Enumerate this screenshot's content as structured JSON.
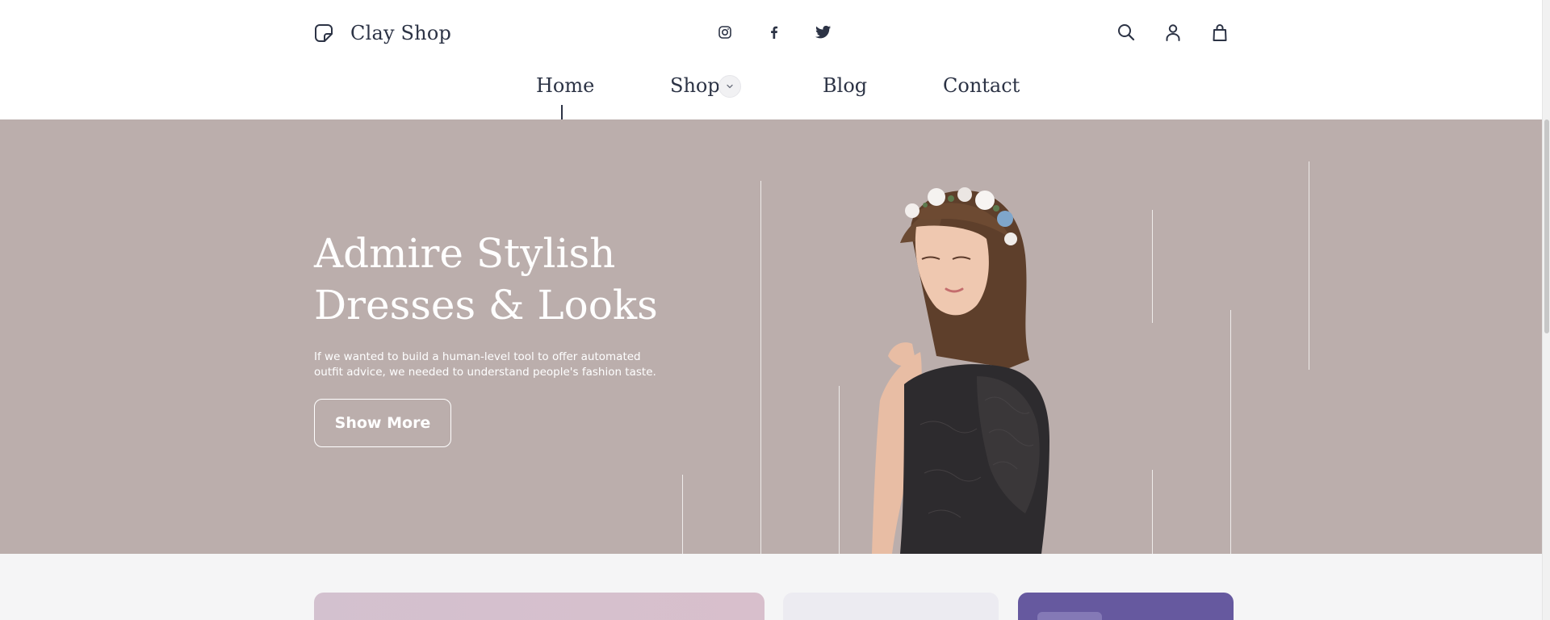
{
  "brand": {
    "name": "Clay Shop",
    "logo_icon": "sticky-note-icon"
  },
  "social": [
    {
      "name": "instagram",
      "icon": "instagram-icon"
    },
    {
      "name": "facebook",
      "icon": "facebook-icon"
    },
    {
      "name": "twitter",
      "icon": "twitter-icon"
    }
  ],
  "utilities": [
    {
      "name": "search",
      "icon": "search-icon"
    },
    {
      "name": "account",
      "icon": "user-icon"
    },
    {
      "name": "cart",
      "icon": "shopping-bag-icon"
    }
  ],
  "nav": {
    "items": [
      {
        "label": "Home",
        "active": true
      },
      {
        "label": "Shop",
        "has_dropdown": true
      },
      {
        "label": "Blog"
      },
      {
        "label": "Contact"
      }
    ],
    "dropdown_icon": "chevron-down-icon"
  },
  "hero": {
    "title_line1": "Admire Stylish",
    "title_line2": "Dresses & Looks",
    "description": "If we wanted to build a human-level tool to offer automated outfit advice, we needed to understand people's fashion taste.",
    "button_label": "Show More"
  },
  "colors": {
    "hero_bg": "#bbaeac",
    "text_dark": "#2c3345",
    "section_bg": "#f5f5f6",
    "card_pink": "#d3c1cf",
    "card_lavender": "#ecebf1",
    "card_purple": "#66599f"
  }
}
